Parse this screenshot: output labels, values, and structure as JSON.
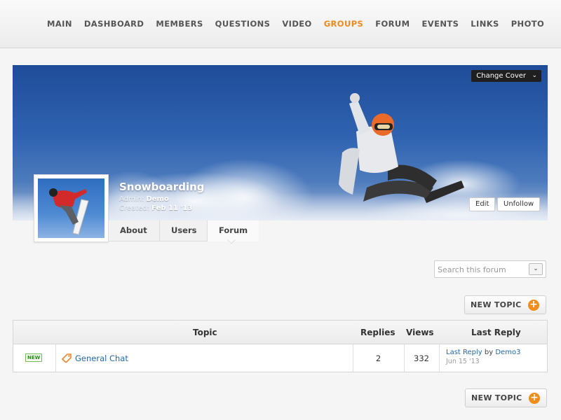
{
  "nav": {
    "items": [
      {
        "label": "MAIN",
        "active": false
      },
      {
        "label": "DASHBOARD",
        "active": false
      },
      {
        "label": "MEMBERS",
        "active": false
      },
      {
        "label": "QUESTIONS",
        "active": false
      },
      {
        "label": "VIDEO",
        "active": false
      },
      {
        "label": "GROUPS",
        "active": true
      },
      {
        "label": "FORUM",
        "active": false
      },
      {
        "label": "EVENTS",
        "active": false
      },
      {
        "label": "LINKS",
        "active": false
      },
      {
        "label": "PHOTO",
        "active": false
      }
    ],
    "active_color": "#ec8a1d"
  },
  "cover": {
    "change_cover_label": "Change Cover",
    "group_name": "Snowboarding",
    "admin_label": "Admin:",
    "admin_value": "Demo",
    "created_label": "Created:",
    "created_value": "Feb 11 '13",
    "edit_label": "Edit",
    "unfollow_label": "Unfollow"
  },
  "tabs": [
    {
      "label": "About"
    },
    {
      "label": "Users"
    },
    {
      "label": "Forum",
      "active": true
    }
  ],
  "search": {
    "placeholder": "Search this forum"
  },
  "new_topic_label": "NEW TOPIC",
  "table": {
    "headers": {
      "topic": "Topic",
      "replies": "Replies",
      "views": "Views",
      "last_reply": "Last Reply"
    },
    "rows": [
      {
        "badge": "NEW",
        "topic": "General Chat",
        "replies": "2",
        "views": "332",
        "last_reply_link": "Last Reply",
        "last_reply_by": "by",
        "last_reply_user": "Demo3",
        "last_reply_date": "Jun 15 '13"
      }
    ]
  },
  "colors": {
    "accent": "#f08d1b",
    "link": "#2468a8",
    "badge_green": "#2f8c1e"
  }
}
